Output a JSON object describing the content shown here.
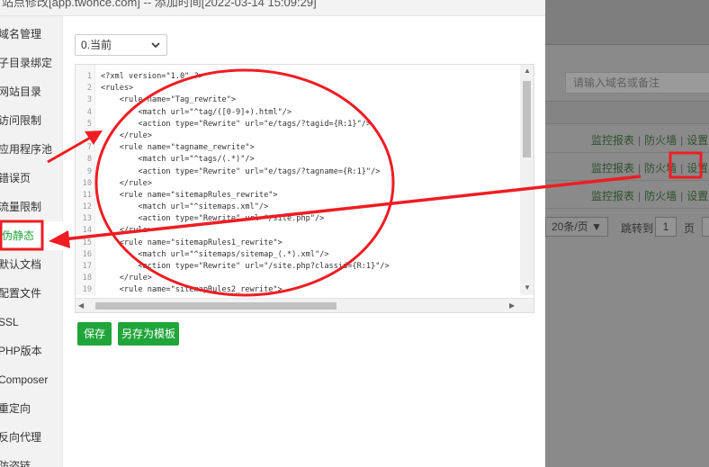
{
  "window": {
    "title": "站点修改[app.twonce.com] -- 添加时间[2022-03-14 15:09:29]"
  },
  "sidebar": {
    "items": [
      {
        "label": "域名管理"
      },
      {
        "label": "子目录绑定"
      },
      {
        "label": "网站目录"
      },
      {
        "label": "访问限制"
      },
      {
        "label": "应用程序池"
      },
      {
        "label": "错误页"
      },
      {
        "label": "流量限制"
      },
      {
        "label": "伪静态"
      },
      {
        "label": "默认文档"
      },
      {
        "label": "配置文件"
      },
      {
        "label": "SSL"
      },
      {
        "label": "PHP版本"
      },
      {
        "label": "Composer"
      },
      {
        "label": "重定向"
      },
      {
        "label": "反向代理"
      },
      {
        "label": "防盗链"
      }
    ]
  },
  "main": {
    "rule_select": {
      "value": "0.当前"
    },
    "editor": {
      "lines": [
        {
          "n": "1",
          "text": "<?xml version=\"1.0\" ?>"
        },
        {
          "n": "2",
          "text": "<rules>"
        },
        {
          "n": "3",
          "text": "    <rule name=\"Tag_rewrite\">"
        },
        {
          "n": "4",
          "text": "        <match url=\"^tag/([0-9]+).html\"/>"
        },
        {
          "n": "5",
          "text": "        <action type=\"Rewrite\" url=\"e/tags/?tagid={R:1}\"/>"
        },
        {
          "n": "6",
          "text": "    </rule>"
        },
        {
          "n": "7",
          "text": "    <rule name=\"tagname_rewrite\">"
        },
        {
          "n": "8",
          "text": "        <match url=\"^tags/(.*)\"/>"
        },
        {
          "n": "9",
          "text": "        <action type=\"Rewrite\" url=\"e/tags/?tagname={R:1}\"/>"
        },
        {
          "n": "10",
          "text": "    </rule>"
        },
        {
          "n": "11",
          "text": "    <rule name=\"sitemapRules_rewrite\">"
        },
        {
          "n": "12",
          "text": "        <match url=\"^sitemaps.xml\"/>"
        },
        {
          "n": "13",
          "text": "        <action type=\"Rewrite\" url=\"/site.php\"/>"
        },
        {
          "n": "14",
          "text": "    </rule>"
        },
        {
          "n": "15",
          "text": "    <rule name=\"sitemapRules1_rewrite\">"
        },
        {
          "n": "16",
          "text": "        <match url=\"^sitemaps/sitemap_(.*).xml\"/>"
        },
        {
          "n": "17",
          "text": "        <action type=\"Rewrite\" url=\"/site.php?classid={R:1}\"/>"
        },
        {
          "n": "18",
          "text": "    </rule>"
        },
        {
          "n": "19",
          "text": "    <rule name=\"sitemapRules2_rewrite\">"
        }
      ]
    },
    "buttons": {
      "save": "保存",
      "save_template": "另存为模板"
    }
  },
  "background": {
    "search_placeholder": "请输入域名或备注",
    "row_actions": {
      "monitor": "监控报表",
      "firewall": "防火墙",
      "settings": "设置"
    },
    "pager": {
      "page_size": "20条/页",
      "jump_label": "跳转到",
      "page": "1",
      "page_unit": "页"
    }
  },
  "colors": {
    "accent": "#20a53a",
    "annotation": "#ee1d23"
  }
}
